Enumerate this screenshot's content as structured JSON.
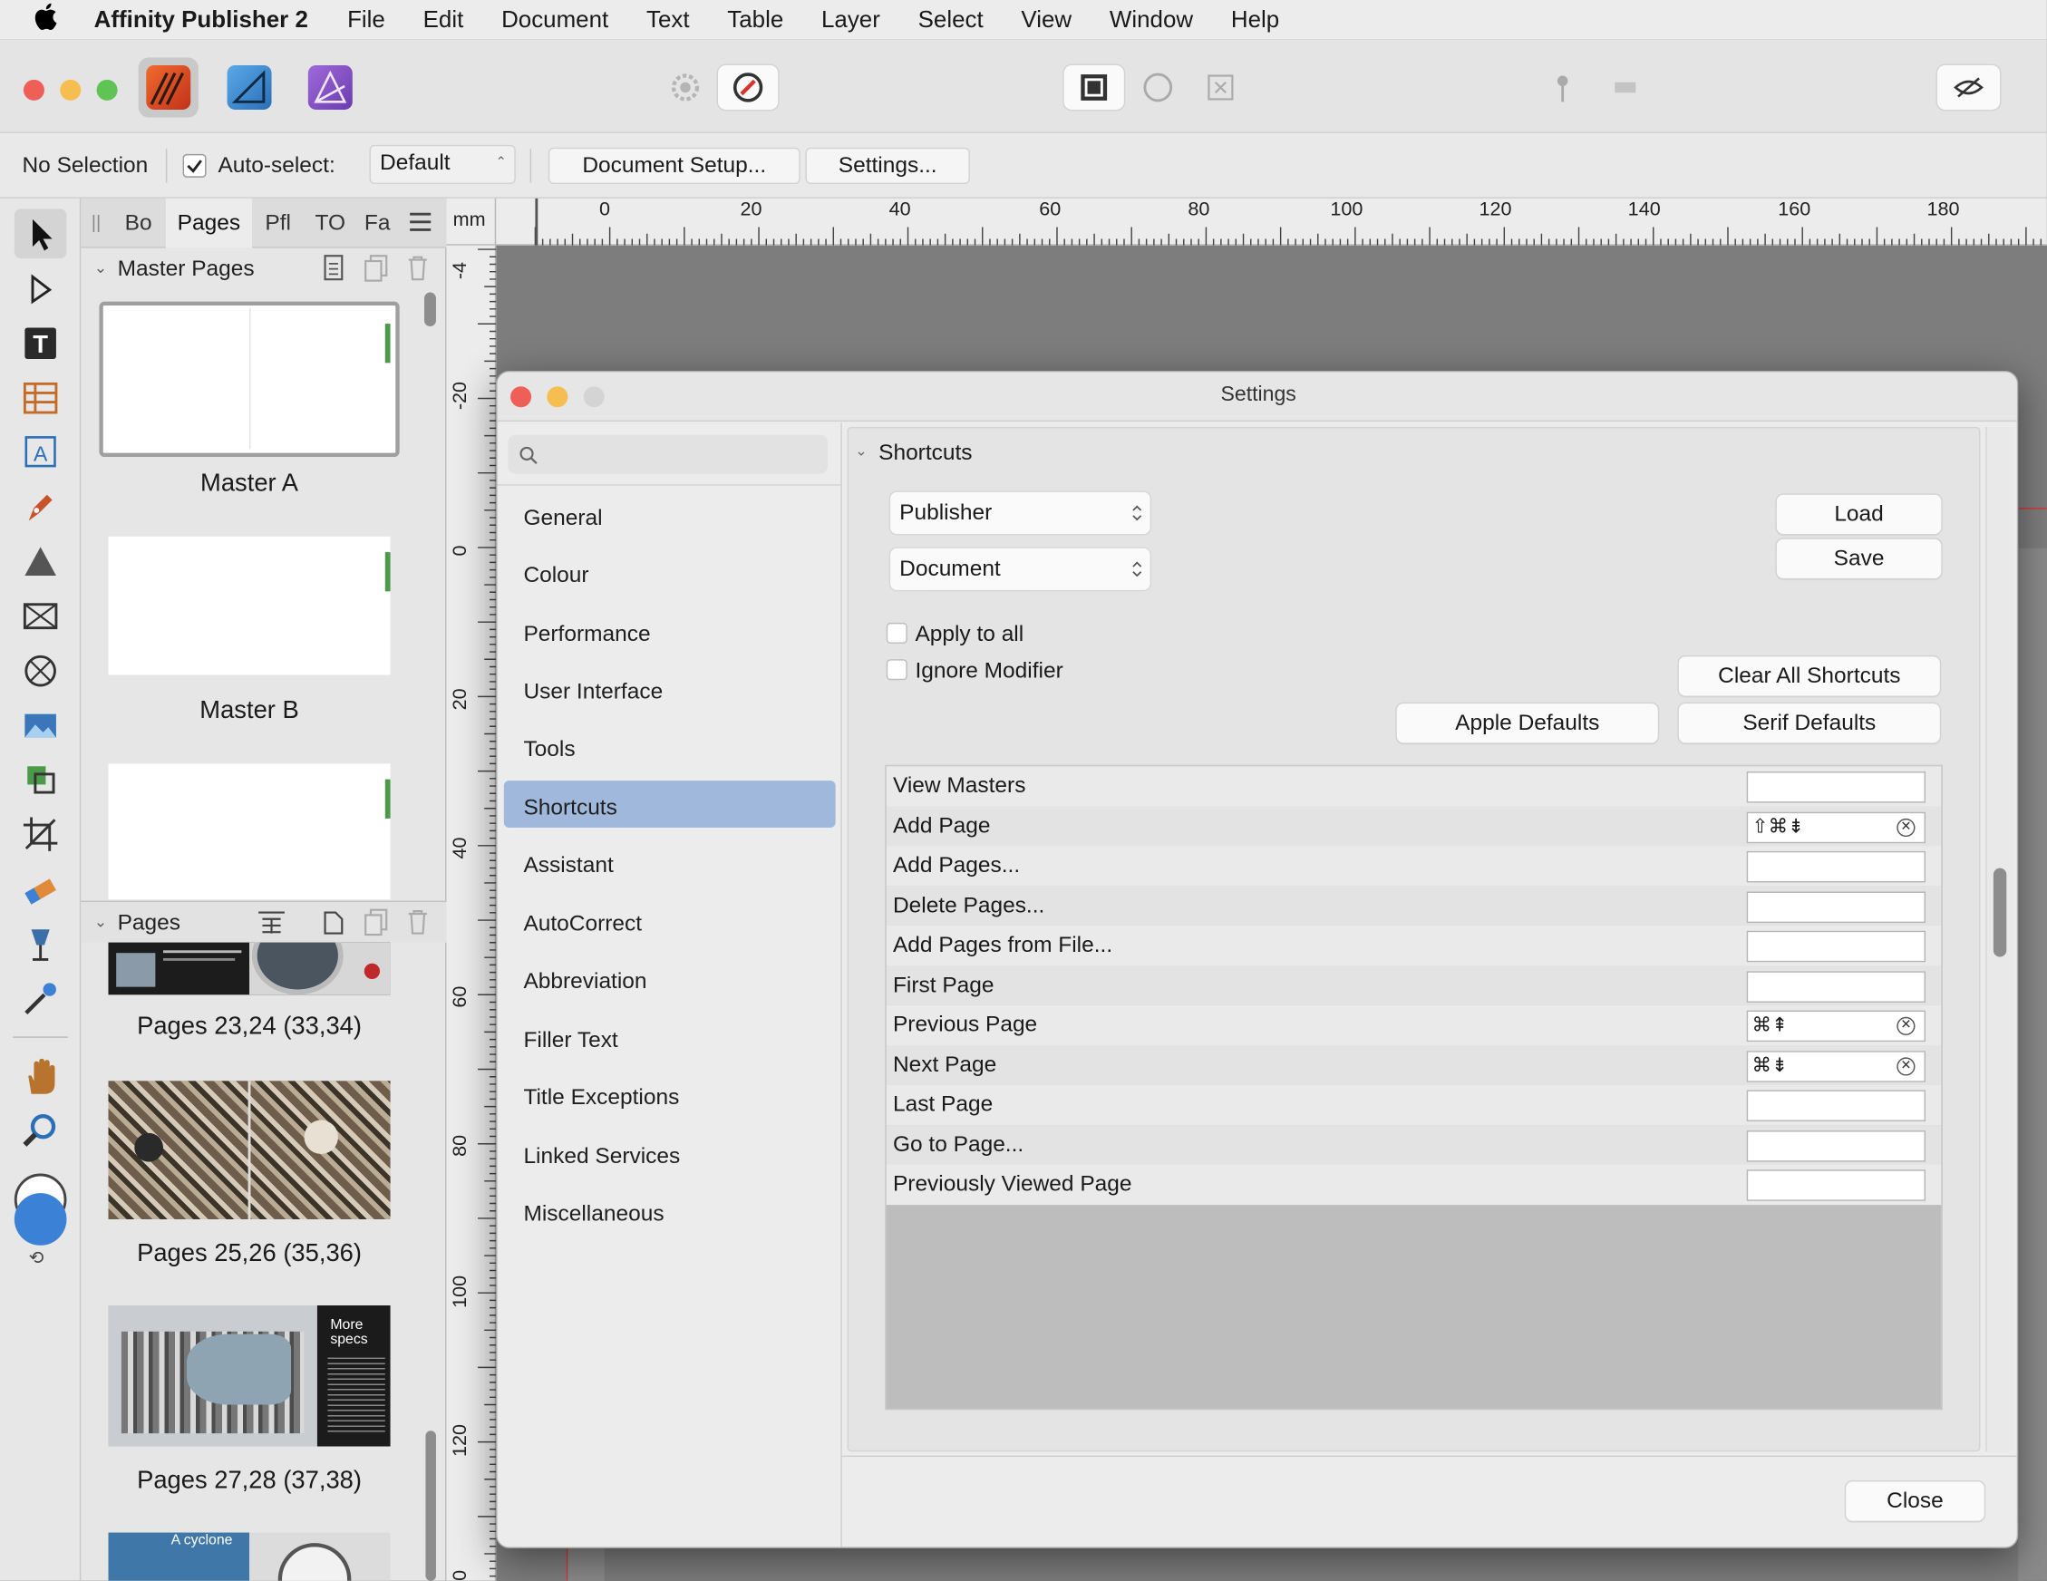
{
  "menubar": {
    "app_name": "Affinity Publisher 2",
    "items": [
      "File",
      "Edit",
      "Document",
      "Text",
      "Table",
      "Layer",
      "Select",
      "View",
      "Window",
      "Help"
    ]
  },
  "context": {
    "selection": "No Selection",
    "autoselect_label": "Auto-select:",
    "autoselect_value": "Default",
    "doc_setup": "Document Setup...",
    "settings": "Settings..."
  },
  "panel": {
    "tabs": [
      "Bo",
      "Pages",
      "Pfl",
      "TO",
      "Fa"
    ],
    "master_pages_header": "Master Pages",
    "masters": [
      "Master A",
      "Master B"
    ],
    "pages_header": "Pages",
    "pages": [
      "Pages 23,24 (33,34)",
      "Pages 25,26 (35,36)",
      "Pages 27,28 (37,38)"
    ],
    "thumb_text_more_specs": "More specs",
    "thumb_text_cyclone": "A cyclone"
  },
  "ruler": {
    "unit": "mm",
    "top_ticks": [
      "0",
      "20",
      "40",
      "60",
      "80",
      "100",
      "120",
      "140",
      "160",
      "180"
    ],
    "left_ticks": [
      "-4",
      "-20",
      "0",
      "20",
      "40",
      "60",
      "80",
      "100",
      "120",
      "0"
    ]
  },
  "dialog": {
    "title": "Settings",
    "search_placeholder": "",
    "sidebar": [
      "General",
      "Colour",
      "Performance",
      "User Interface",
      "Tools",
      "Shortcuts",
      "Assistant",
      "AutoCorrect",
      "Abbreviation",
      "Filler Text",
      "Title Exceptions",
      "Linked Services",
      "Miscellaneous"
    ],
    "selected": "Shortcuts",
    "section_title": "Shortcuts",
    "app_popup": "Publisher",
    "category_popup": "Document",
    "load": "Load",
    "save": "Save",
    "apply_to_all": "Apply to all",
    "ignore_modifier": "Ignore Modifier",
    "clear_all": "Clear All Shortcuts",
    "apple_defaults": "Apple Defaults",
    "serif_defaults": "Serif Defaults",
    "close": "Close",
    "shortcuts": [
      {
        "name": "View Masters",
        "key": ""
      },
      {
        "name": "Add Page",
        "key": "⇧⌘⇟"
      },
      {
        "name": "Add Pages...",
        "key": ""
      },
      {
        "name": "Delete Pages...",
        "key": ""
      },
      {
        "name": "Add Pages from File...",
        "key": ""
      },
      {
        "name": "First Page",
        "key": ""
      },
      {
        "name": "Previous Page",
        "key": "⌘⇞"
      },
      {
        "name": "Next Page",
        "key": "⌘⇟"
      },
      {
        "name": "Last Page",
        "key": ""
      },
      {
        "name": "Go to Page...",
        "key": ""
      },
      {
        "name": "Previously Viewed Page",
        "key": ""
      }
    ]
  },
  "colors": {
    "accent_selected": "#9fb8dc",
    "close_red": "#ee5f57",
    "min_yellow": "#f6be50",
    "max_green": "#5fc453",
    "fill_blue": "#3b82d6"
  }
}
